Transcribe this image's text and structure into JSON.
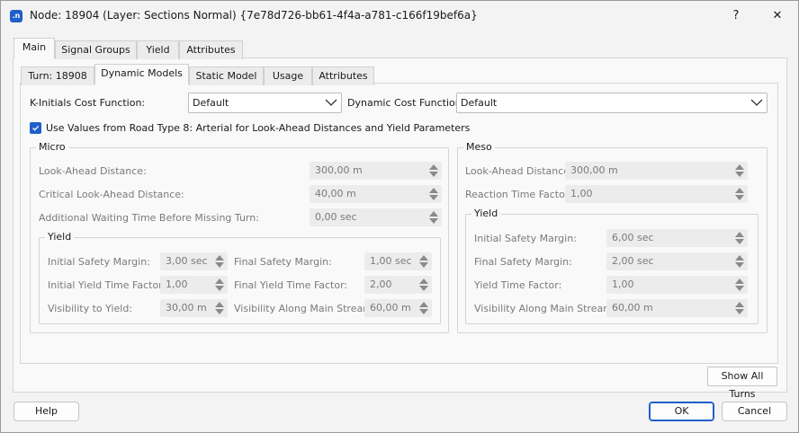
{
  "window": {
    "title": "Node: 18904 (Layer: Sections Normal) {7e78d726-bb61-4f4a-a781-c166f19bef6a}",
    "app_icon": ".n",
    "help_glyph": "?",
    "close_glyph": "✕"
  },
  "outer_tabs": [
    {
      "label": "Main",
      "active": true
    },
    {
      "label": "Signal Groups"
    },
    {
      "label": "Yield"
    },
    {
      "label": "Attributes"
    }
  ],
  "inner_tabs": [
    {
      "label": "Turn: 18908"
    },
    {
      "label": "Dynamic Models",
      "active": true
    },
    {
      "label": "Static Model"
    },
    {
      "label": "Usage"
    },
    {
      "label": "Attributes"
    }
  ],
  "k_initials": {
    "label": "K-Initials Cost Function:",
    "value": "Default"
  },
  "dynamic_cost": {
    "label": "Dynamic Cost Function:",
    "value": "Default"
  },
  "use_values": {
    "label": "Use Values from Road Type 8: Arterial for Look-Ahead Distances and Yield Parameters",
    "checked": true
  },
  "micro": {
    "title": "Micro",
    "fields": [
      {
        "label": "Look-Ahead Distance:",
        "value": "300,00 m"
      },
      {
        "label": "Critical Look-Ahead Distance:",
        "value": "40,00 m"
      },
      {
        "label": "Additional Waiting Time Before Missing Turn:",
        "value": "0,00 sec"
      }
    ],
    "yield": {
      "title": "Yield",
      "left": [
        {
          "label": "Initial Safety Margin:",
          "value": "3,00 sec"
        },
        {
          "label": "Initial Yield Time Factor:",
          "value": "1,00"
        },
        {
          "label": "Visibility to Yield:",
          "value": "30,00 m"
        }
      ],
      "right": [
        {
          "label": "Final Safety Margin:",
          "value": "1,00 sec"
        },
        {
          "label": "Final Yield Time Factor:",
          "value": "2,00"
        },
        {
          "label": "Visibility Along Main Stream:",
          "value": "60,00 m"
        }
      ]
    }
  },
  "meso": {
    "title": "Meso",
    "fields": [
      {
        "label": "Look-Ahead Distance:",
        "value": "300,00 m"
      },
      {
        "label": "Reaction Time Factor:",
        "value": "1,00"
      }
    ],
    "yield": {
      "title": "Yield",
      "fields": [
        {
          "label": "Initial Safety Margin:",
          "value": "6,00 sec"
        },
        {
          "label": "Final Safety Margin:",
          "value": "2,00 sec"
        },
        {
          "label": "Yield Time Factor:",
          "value": "1,00"
        },
        {
          "label": "Visibility Along Main Stream:",
          "value": "60,00 m"
        }
      ]
    }
  },
  "buttons": {
    "show_all_turns": "Show All Turns",
    "help": "Help",
    "ok": "OK",
    "cancel": "Cancel"
  },
  "colors": {
    "accent": "#1f5fc9"
  }
}
